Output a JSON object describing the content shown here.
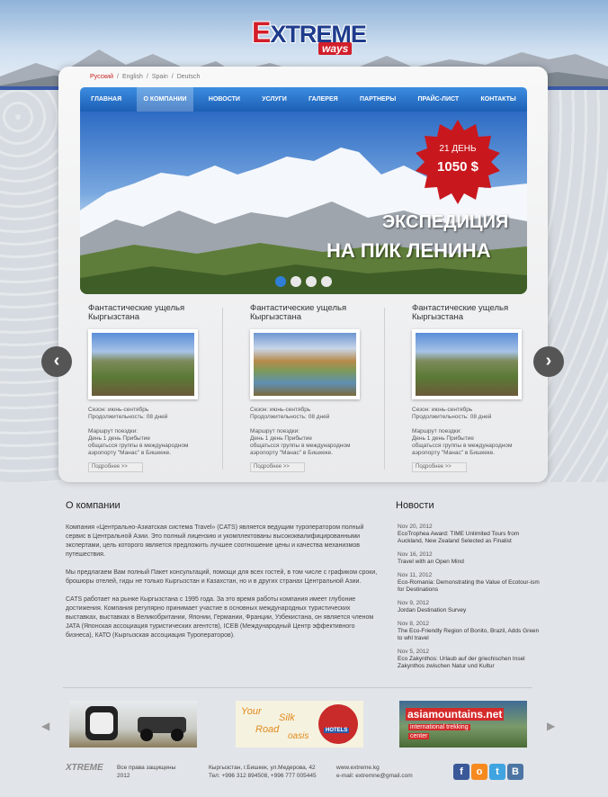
{
  "logo": {
    "word_first": "E",
    "word_rest": "XTREME",
    "sub": "ways"
  },
  "languages": [
    "Русский",
    "English",
    "Spain",
    "Deutsch"
  ],
  "lang_sep": "/",
  "nav": [
    "ГЛАВНАЯ",
    "О КОМПАНИИ",
    "НОВОСТИ",
    "УСЛУГИ",
    "ГАЛЕРЕЯ",
    "ПАРТНЕРЫ",
    "ПРАЙС-ЛИСТ",
    "КОНТАКТЫ"
  ],
  "hero": {
    "badge_days": "21 ДЕНЬ",
    "badge_price": "1050 $",
    "line1": "ЭКСПЕДИЦИЯ",
    "line2": "НА ПИК ЛЕНИНА"
  },
  "tours": [
    {
      "title1": "Фантастические ущелья",
      "title2": "Кыргызстана",
      "season": "Сезон: июнь-сентябрь",
      "duration": "Продолжительность: 08 дней",
      "route": "Маршрут поездки:",
      "day1": "День 1 день Прибытие",
      "desc1": "общатьсся группы в международном",
      "desc2": "аэропорту \"Манас\" в Бишкеке.",
      "more": "Подробнее >>"
    },
    {
      "title1": "Фантастические ущелья",
      "title2": "Кыргызстана",
      "season": "Сезон: июнь-сентябрь",
      "duration": "Продолжительность: 08 дней",
      "route": "Маршрут поездки:",
      "day1": "День 1 день Прибытие",
      "desc1": "общатьсся группы в международном",
      "desc2": "аэропорту \"Манас\" в Бишкеке.",
      "more": "Подробнее >>"
    },
    {
      "title1": "Фантастические ущелья",
      "title2": "Кыргызстана",
      "season": "Сезон: июнь-сентябрь",
      "duration": "Продолжительность: 08 дней",
      "route": "Маршрут поездки:",
      "day1": "День 1 день Прибытие",
      "desc1": "общатьсся группы в международном",
      "desc2": "аэропорту \"Манас\" в Бишкеке.",
      "more": "Подробнее >>"
    }
  ],
  "arrows": {
    "prev": "‹",
    "next": "›"
  },
  "about": {
    "heading": "О компании",
    "p1": "Компания «Центрально-Азиатская система Travel» (CATS) является ведущим туроператором полный сервис в Центральной Азии. Это полный лицензию и укомплектованы высококвалифицированными экспертами, цель которого является предложить лучшее соотношение цены и качества механизмов путешествия.",
    "p2": "Мы предлагаем Вам полный Пакет консультаций, помощи для всех гостей, в том числе с графиком сроки, брошюры отелей, гиды не только Кыргызстан и Казахстан, но и в других странах Центральной Азии.",
    "p3": "CATS работает на рынке Кыргызстана с 1995 года. За это время работы компания имеет глубоние достижения. Компания регулярно принимает участие в основных международных туристических выставках, выставках в Великобритании, Японии, Германии, Франции, Узбекистана, он является членом JATA (Японская ассоциация туристических агентств), ICEB (Международный Центр эффективного бизнеса), КАТО (Кыргызская ассоциация Туроператоров)."
  },
  "news": {
    "heading": "Новости",
    "items": [
      {
        "date": "Nov 20, 2012",
        "text": "EcoTrophea Award: TIME Unlimited Tours from Auckland, New Zealand Selected as Finalist"
      },
      {
        "date": "Nov 16, 2012",
        "text": "Travel with an Open Mind"
      },
      {
        "date": "Nov 11, 2012",
        "text": "Eco-Romania: Demonstrating the Value of Ecotour-ism for Destinations"
      },
      {
        "date": "Nov 9, 2012",
        "text": "Jordan Destination Survey"
      },
      {
        "date": "Nov 8, 2012",
        "text": "The Eco-Friendly Region of Bonito, Brazil, Adds Green to whl travel"
      },
      {
        "date": "Nov 5, 2012",
        "text": "Eco Zakynthos: Urlaub auf der griechischen Insel Zakynthos zwischen Natur und Kultur"
      }
    ]
  },
  "banners": {
    "silk_your": "Your",
    "silk_silk": "Silk",
    "silk_road": "Road",
    "silk_oasis": "oasis",
    "silk_hotels": "HOTELS",
    "asia_title": "asiamountains.net",
    "asia_sub1": "international trekking",
    "asia_sub2": "center"
  },
  "footer": {
    "rights1": "Все права защищены",
    "rights2": "2012",
    "addr1": "Кыргызстан, г.Бишкек, ул.Медерова, 42",
    "addr2": "Тел: +996 312 894508, +996 777 005445",
    "web": "www.extreme.kg",
    "email": "e-mail: extremne@gmail.com"
  },
  "social": [
    {
      "letter": "f",
      "color": "#3b5998"
    },
    {
      "letter": "o",
      "color": "#f68a1f"
    },
    {
      "letter": "t",
      "color": "#3fa4e0"
    },
    {
      "letter": "B",
      "color": "#4c75a3"
    }
  ]
}
